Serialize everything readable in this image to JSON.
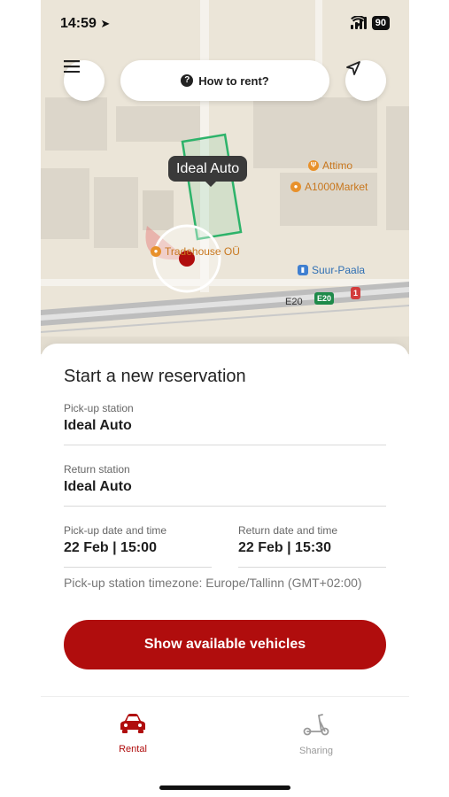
{
  "status_bar": {
    "time": "14:59",
    "battery": "90"
  },
  "map": {
    "how_to_rent": "How to rent?",
    "station_label": "Ideal Auto",
    "pois": {
      "attimo": "Attimo",
      "a1000market": "A1000Market",
      "tradehouse": "Tradehouse OÜ",
      "suur_paala": "Suur-Paala"
    },
    "road_label": "E20",
    "road_shield": "E20",
    "route_shield": "1"
  },
  "reservation": {
    "title": "Start a new reservation",
    "pickup_station_label": "Pick-up station",
    "pickup_station_value": "Ideal Auto",
    "return_station_label": "Return station",
    "return_station_value": "Ideal Auto",
    "pickup_datetime_label": "Pick-up date and time",
    "pickup_datetime_value": "22 Feb | 15:00",
    "return_datetime_label": "Return date and time",
    "return_datetime_value": "22 Feb | 15:30",
    "timezone_note": "Pick-up station timezone: Europe/Tallinn (GMT+02:00)",
    "cta_label": "Show available vehicles"
  },
  "tabs": [
    {
      "label": "Rental",
      "active": true,
      "icon": "car-icon"
    },
    {
      "label": "Sharing",
      "active": false,
      "icon": "scooter-icon"
    }
  ],
  "colors": {
    "accent": "#b00d0d",
    "tab_inactive": "#9a9a9a",
    "station_outline": "#2db36a"
  }
}
